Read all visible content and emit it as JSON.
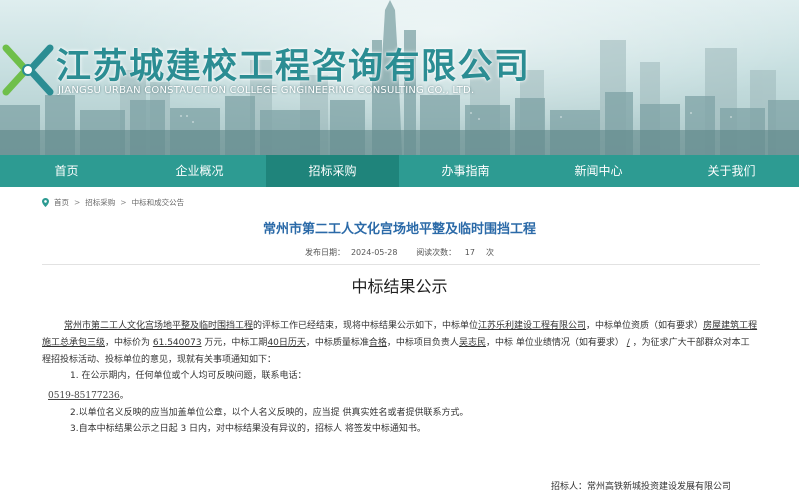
{
  "header": {
    "company_name_cn": "江苏城建校工程咨询有限公司",
    "company_name_en": "JIANGSU URBAN CONSTAUCTION COLLEGE GNGINEERING CONSULTING CO., LTD.",
    "brand_color": "#2b8d93"
  },
  "nav": {
    "items": [
      "首页",
      "企业概况",
      "招标采购",
      "办事指南",
      "新闻中心",
      "关于我们"
    ],
    "active": "招标采购",
    "bg_color": "#2d9b92",
    "active_color": "#1f847b"
  },
  "breadcrumb": [
    "首页",
    "招标采购",
    "中标和成交公告"
  ],
  "article": {
    "title": "常州市第二工人文化宫场地平整及临时围挡工程",
    "publish_label": "发布日期：",
    "publish_date": "2024-05-28",
    "reads_label": "阅读次数：",
    "reads": "17",
    "reads_unit": "次",
    "doc_title": "中标结果公示",
    "body": {
      "project_name": "常州市第二工人文化宫场地平整及临时围挡工程",
      "t1": "的评标工作已经结束，现将中标结果公示如下，中标单位",
      "winner": "江苏乐利建设工程有限公司",
      "t2": "，中标单位资质（如有要求）",
      "qualification": "房屋建筑工程施工总承包三级",
      "t3": "，中标价为 ",
      "price": "61.540073",
      "t4": " 万元，中标工期",
      "period": "40日历天",
      "t5": "，中标质量标准",
      "quality": "合格",
      "t6": "，中标项目负责人",
      "manager": "吴志民",
      "t7": "，中标 单位业绩情况（如有要求）",
      "performance": "/",
      "t8": "，为征求广大干部群众对本工 程招投标活动、投标单位的意见，现就有关事项通知如下："
    },
    "item1": "1. 在公示期内，任何单位或个人均可反映问题，联系电话：",
    "phone": "0519-85177236",
    "phone_end": "。",
    "item2": "2.以单位名义反映的应当加盖单位公章，以个人名义反映的，应当提 供真实姓名或者提供联系方式。",
    "item3": "3.自本中标结果公示之日起 3 日内，对中标结果没有异议的，招标人 将签发中标通知书。",
    "signer_label": "招标人：",
    "signer": "常州高铁新城投资建设发展有限公司"
  }
}
